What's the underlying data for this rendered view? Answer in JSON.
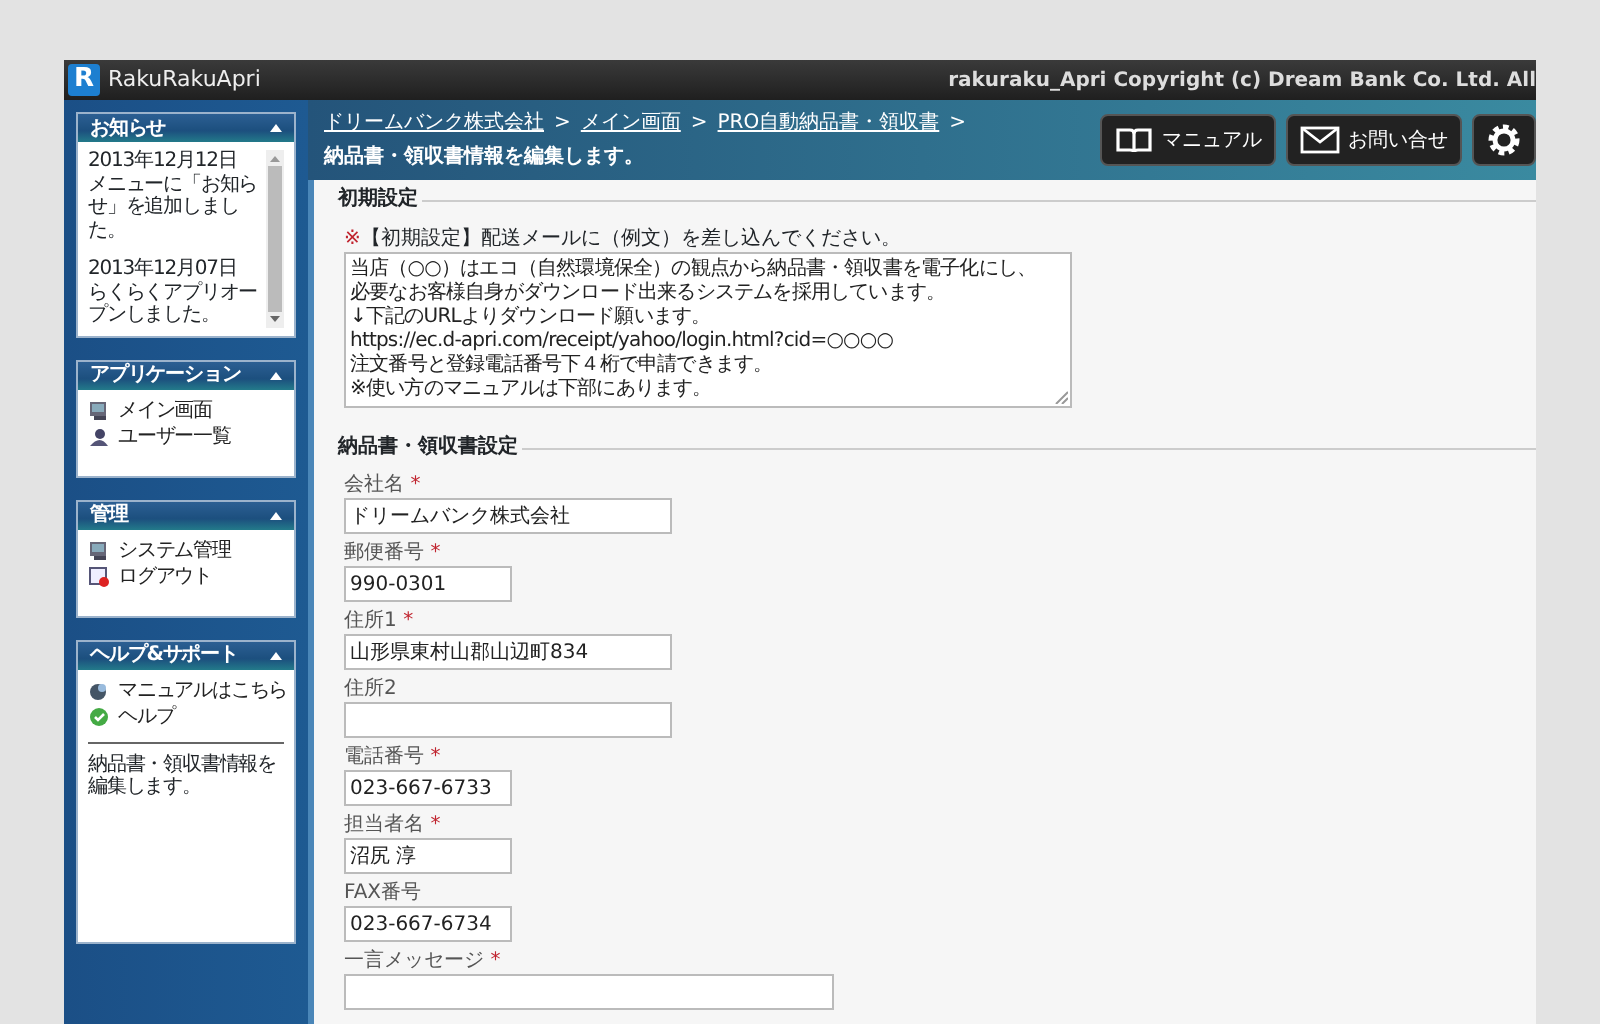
{
  "app": {
    "logo_letter": "R",
    "name": "RakuRakuApri",
    "copyright": "rakuraku_Apri Copyright (c) Dream Bank Co. Ltd. All"
  },
  "sidebar": {
    "panels": [
      {
        "kind": "notices",
        "title": "お知らせ",
        "notices": [
          {
            "date": "2013年12月12日",
            "text": "メニューに「お知らせ」を追加しました。"
          },
          {
            "date": "2013年12月07日",
            "text": "らくらくアプリオープンしました。"
          }
        ]
      },
      {
        "kind": "menu",
        "title": "アプリケーション",
        "items": [
          {
            "label": "メイン画面"
          },
          {
            "label": "ユーザー一覧"
          }
        ]
      },
      {
        "kind": "menu",
        "title": "管理",
        "items": [
          {
            "label": "システム管理"
          },
          {
            "label": "ログアウト"
          }
        ]
      },
      {
        "kind": "help",
        "title": "ヘルプ&サポート",
        "items": [
          {
            "label": "マニュアルはこちら"
          },
          {
            "label": "ヘルプ"
          }
        ],
        "description": "納品書・領収書情報を編集します。"
      }
    ]
  },
  "breadcrumb": [
    "ドリームバンク株式会社",
    "メイン画面",
    "PRO自動納品書・領収書"
  ],
  "breadcrumb_separator": ">",
  "page_title": "納品書・領収書情報を編集します。",
  "header_buttons": [
    {
      "kind": "manual",
      "label": "マニュアル"
    },
    {
      "kind": "contact",
      "label": "お問い合せ"
    },
    {
      "kind": "settings"
    }
  ],
  "sections": [
    {
      "kind": "template",
      "title": "初期設定",
      "note_mark": "※",
      "note": "【初期設定】配送メールに（例文）を差し込んでください。",
      "lines": [
        "当店（○○）はエコ（自然環境保全）の観点から納品書・領収書を電子化にし、",
        "必要なお客様自身がダウンロード出来るシステムを採用しています。",
        "↓下記のURLよりダウンロード願います。",
        "https://ec.d-apri.com/receipt/yahoo/login.html?cid=○○○○",
        "注文番号と登録電話番号下４桁で申請できます。",
        "※使い方のマニュアルは下部にあります。"
      ]
    },
    {
      "kind": "fields",
      "title": "納品書・領収書設定",
      "fields": [
        {
          "label": "会社名",
          "mark": "*",
          "value": "ドリームバンク株式会社"
        },
        {
          "label": "郵便番号",
          "mark": "*",
          "value": "990-0301"
        },
        {
          "label": "住所1",
          "mark": "*",
          "value": "山形県東村山郡山辺町834"
        },
        {
          "label": "住所2"
        },
        {
          "label": "電話番号",
          "mark": "*",
          "value": "023-667-6733"
        },
        {
          "label": "担当者名",
          "mark": "*",
          "value": "沼尻 淳"
        },
        {
          "label": "FAX番号",
          "value": "023-667-6734"
        },
        {
          "label": "一言メッセージ",
          "mark": "*"
        }
      ]
    }
  ]
}
